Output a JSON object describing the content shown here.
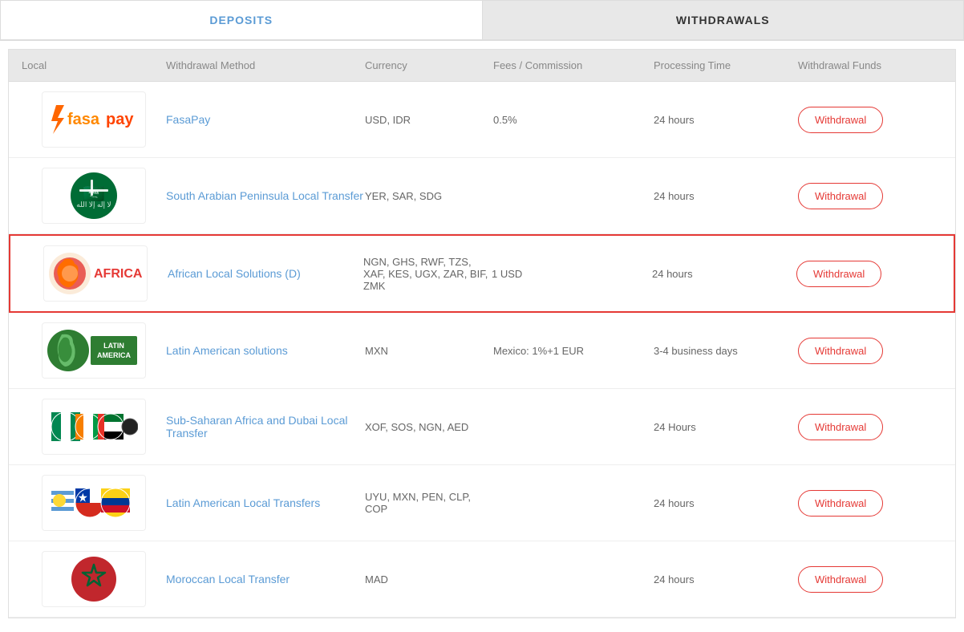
{
  "tabs": {
    "deposits": {
      "label": "DEPOSITS"
    },
    "withdrawals": {
      "label": "WITHDRAWALS"
    }
  },
  "table": {
    "headers": {
      "local": "Local",
      "method": "Withdrawal Method",
      "currency": "Currency",
      "fees": "Fees / Commission",
      "processing": "Processing Time",
      "funds": "Withdrawal Funds"
    },
    "rows": [
      {
        "id": "fasapay",
        "method": "FasaPay",
        "currency": "USD, IDR",
        "fees": "0.5%",
        "processing": "24 hours",
        "button": "Withdrawal",
        "highlighted": false
      },
      {
        "id": "south-arabian",
        "method": "South Arabian Peninsula Local Transfer",
        "currency": "YER, SAR, SDG",
        "fees": "",
        "processing": "24 hours",
        "button": "Withdrawal",
        "highlighted": false
      },
      {
        "id": "african",
        "method": "African Local Solutions (D)",
        "currency": "NGN, GHS, RWF, TZS, XAF, KES, UGX, ZAR, BIF, ZMK",
        "fees": "1 USD",
        "processing": "24 hours",
        "button": "Withdrawal",
        "highlighted": true
      },
      {
        "id": "latin-american",
        "method": "Latin American solutions",
        "currency": "MXN",
        "fees": "Mexico: 1%+1 EUR",
        "processing": "3-4 business days",
        "button": "Withdrawal",
        "highlighted": false
      },
      {
        "id": "sub-saharan",
        "method": "Sub-Saharan Africa and Dubai Local Transfer",
        "currency": "XOF, SOS, NGN, AED",
        "fees": "",
        "processing": "24 Hours",
        "button": "Withdrawal",
        "highlighted": false
      },
      {
        "id": "latin-local",
        "method": "Latin American Local Transfers",
        "currency": "UYU, MXN, PEN, CLP, COP",
        "fees": "",
        "processing": "24 hours",
        "button": "Withdrawal",
        "highlighted": false
      },
      {
        "id": "moroccan",
        "method": "Moroccan Local Transfer",
        "currency": "MAD",
        "fees": "",
        "processing": "24 hours",
        "button": "Withdrawal",
        "highlighted": false
      }
    ]
  }
}
